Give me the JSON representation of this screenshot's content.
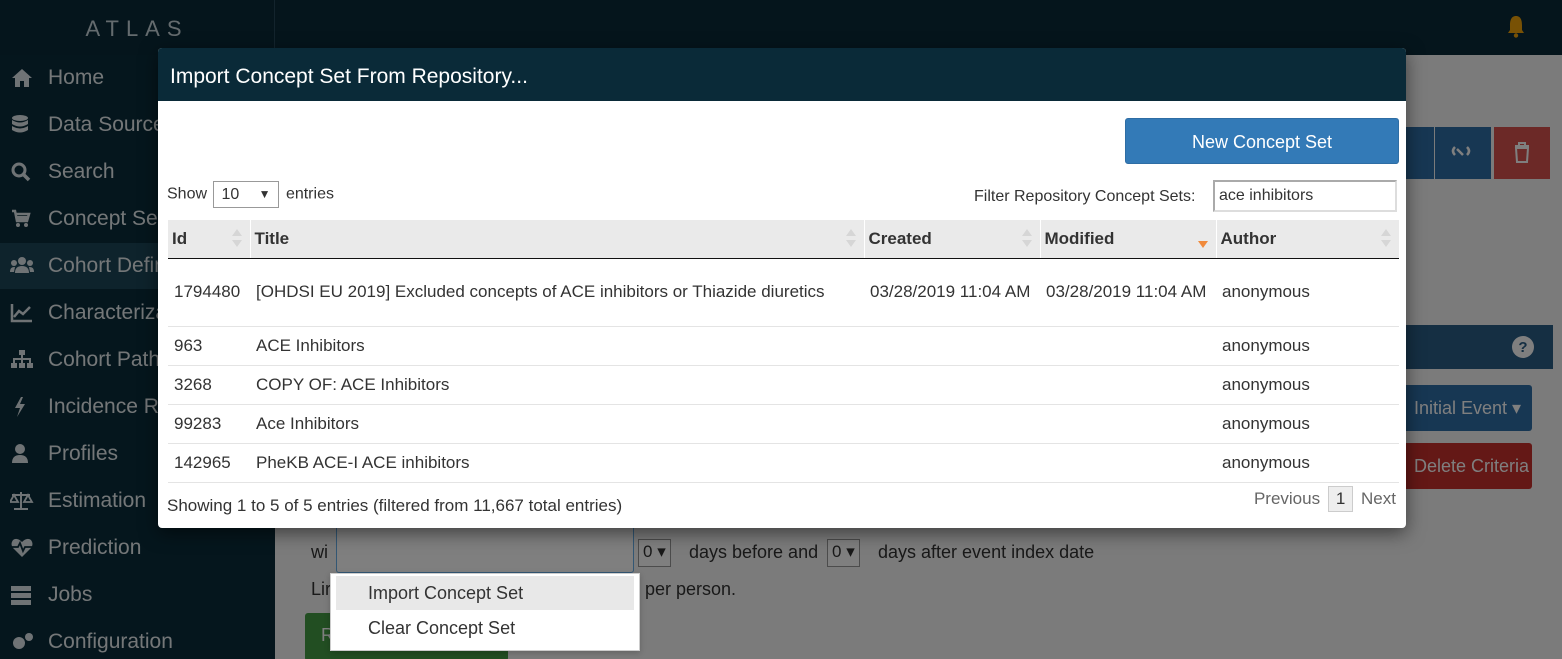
{
  "app": {
    "logo": "ATLAS"
  },
  "sidebar": {
    "items": [
      {
        "label": "Home",
        "icon": "home-icon"
      },
      {
        "label": "Data Sources",
        "icon": "database-icon"
      },
      {
        "label": "Search",
        "icon": "search-icon"
      },
      {
        "label": "Concept Sets",
        "icon": "cart-icon"
      },
      {
        "label": "Cohort Definitions",
        "icon": "users-icon"
      },
      {
        "label": "Characterizations",
        "icon": "line-chart-icon"
      },
      {
        "label": "Cohort Pathways",
        "icon": "sitemap-icon"
      },
      {
        "label": "Incidence Rates",
        "icon": "bolt-icon"
      },
      {
        "label": "Profiles",
        "icon": "user-icon"
      },
      {
        "label": "Estimation",
        "icon": "balance-icon"
      },
      {
        "label": "Prediction",
        "icon": "heartbeat-icon"
      },
      {
        "label": "Jobs",
        "icon": "server-icon"
      },
      {
        "label": "Configuration",
        "icon": "gears-icon"
      }
    ],
    "active_index": 4
  },
  "background": {
    "initial_event_label": "Initial Event ▾",
    "delete_criteria_label": "Delete Criteria",
    "within_prefix": "wi",
    "days_before_value": "0",
    "days_before_text": "days before and",
    "days_after_value": "0",
    "days_after_text": "days after event index date",
    "limit_prefix": "Lir",
    "limit_suffix": "per person.",
    "green_prefix": "R"
  },
  "context_menu": {
    "items": [
      "Import Concept Set",
      "Clear Concept Set"
    ]
  },
  "modal": {
    "title": "Import Concept Set From Repository...",
    "new_button": "New Concept Set",
    "show_label": "Show",
    "page_length": "10",
    "entries_label": "entries",
    "filter_label": "Filter Repository Concept Sets:",
    "filter_value": "ace inhibitors",
    "columns": [
      "Id",
      "Title",
      "Created",
      "Modified",
      "Author"
    ],
    "rows": [
      {
        "id": "1794480",
        "title": "[OHDSI EU 2019] Excluded concepts of ACE inhibitors or Thiazide diuretics",
        "created": "03/28/2019 11:04 AM",
        "modified": "03/28/2019 11:04 AM",
        "author": "anonymous"
      },
      {
        "id": "963",
        "title": "ACE Inhibitors",
        "created": "",
        "modified": "",
        "author": "anonymous"
      },
      {
        "id": "3268",
        "title": "COPY OF: ACE Inhibitors",
        "created": "",
        "modified": "",
        "author": "anonymous"
      },
      {
        "id": "99283",
        "title": "Ace Inhibitors",
        "created": "",
        "modified": "",
        "author": "anonymous"
      },
      {
        "id": "142965",
        "title": "PheKB ACE-I ACE inhibitors",
        "created": "",
        "modified": "",
        "author": "anonymous"
      }
    ],
    "info": "Showing 1 to 5 of 5 entries (filtered from 11,667 total entries)",
    "pager": {
      "previous": "Previous",
      "current": "1",
      "next": "Next"
    }
  },
  "colors": {
    "header_bg": "#0a2a38",
    "primary": "#337ab7",
    "danger": "#c9302c",
    "sort_active": "#f08a3c",
    "bell": "#f0a30a"
  }
}
